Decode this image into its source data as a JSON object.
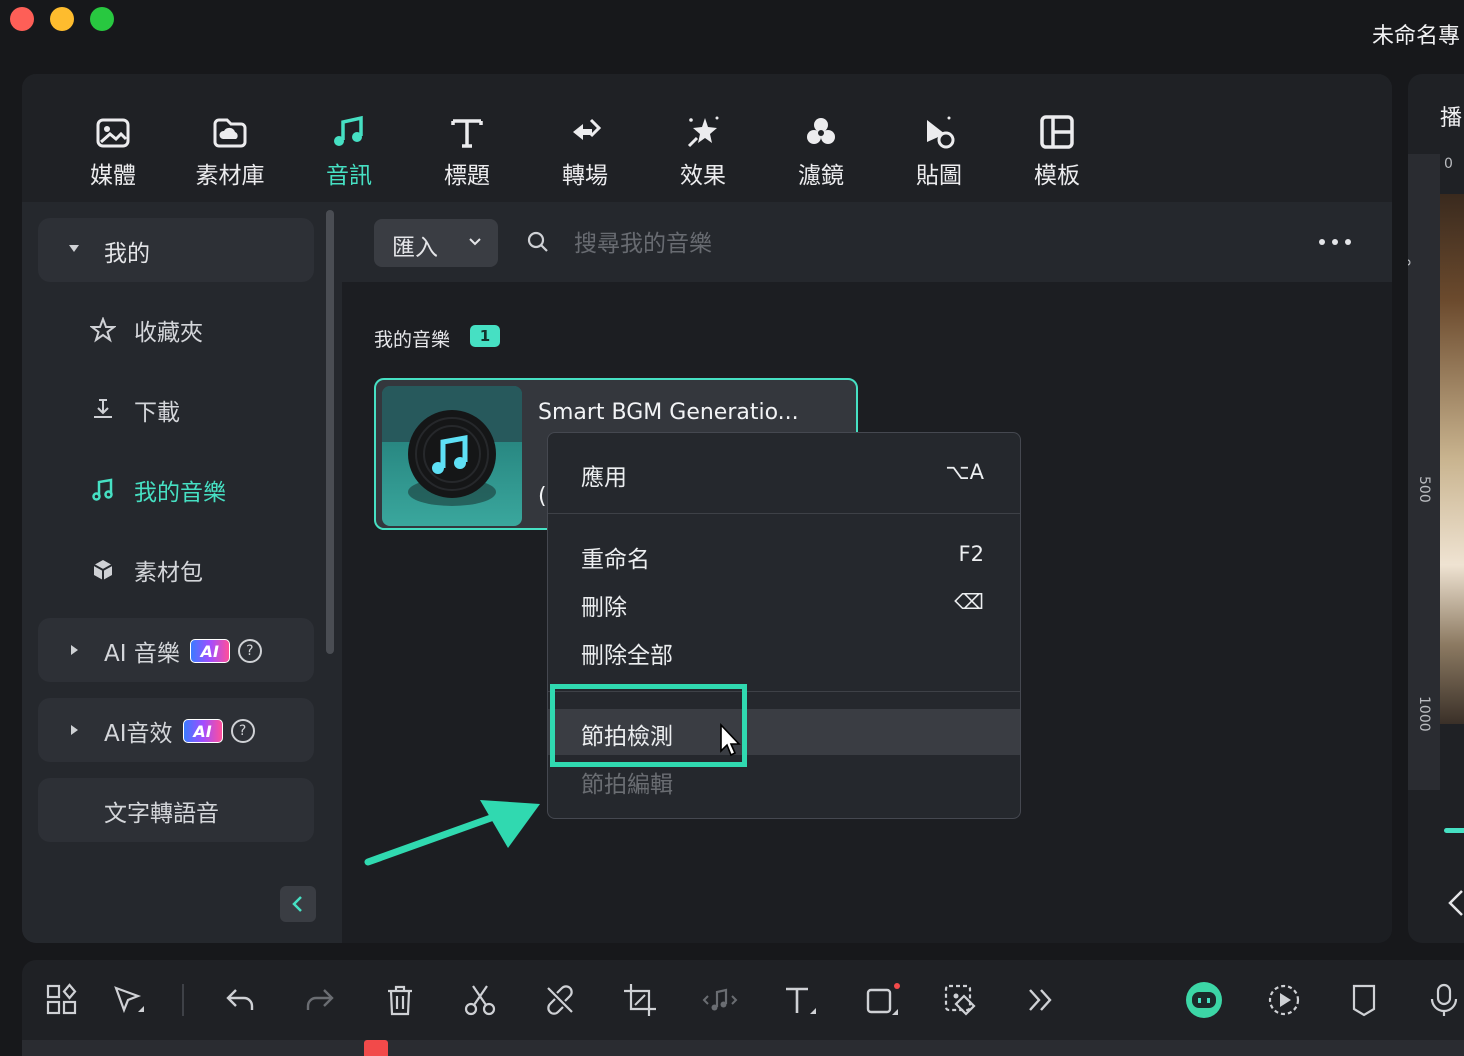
{
  "window": {
    "title": "未命名專",
    "traffic_colors": {
      "close": "#fe5f57",
      "minimize": "#febc2e",
      "zoom": "#28c840"
    }
  },
  "colors": {
    "accent": "#46e0c3",
    "highlight": "#30d9b0",
    "playhead": "#f24a4a"
  },
  "tabs": [
    {
      "label": "媒體",
      "icon": "media-icon"
    },
    {
      "label": "素材庫",
      "icon": "cloud-folder-icon"
    },
    {
      "label": "音訊",
      "icon": "music-note-icon",
      "active": true
    },
    {
      "label": "標題",
      "icon": "title-t-icon"
    },
    {
      "label": "轉場",
      "icon": "transition-icon"
    },
    {
      "label": "效果",
      "icon": "effects-icon"
    },
    {
      "label": "濾鏡",
      "icon": "filters-icon"
    },
    {
      "label": "貼圖",
      "icon": "stickers-icon"
    },
    {
      "label": "模板",
      "icon": "templates-icon"
    }
  ],
  "sidebar": {
    "my_group": "我的",
    "items": [
      {
        "label": "收藏夾",
        "icon": "star-icon"
      },
      {
        "label": "下載",
        "icon": "download-icon"
      },
      {
        "label": "我的音樂",
        "icon": "music-note-icon",
        "active": true
      },
      {
        "label": "素材包",
        "icon": "package-icon"
      }
    ],
    "ai_music": "AI 音樂",
    "ai_sfx": "AI音效",
    "ai_badge": "AI",
    "help_glyph": "?",
    "tts": "文字轉語音"
  },
  "toolbar": {
    "import_label": "匯入",
    "search_placeholder": "搜尋我的音樂"
  },
  "content": {
    "section_title": "我的音樂",
    "count": "1",
    "card": {
      "title": "Smart BGM Generatio...",
      "sub": "("
    }
  },
  "context_menu": {
    "items": [
      {
        "label": "應用",
        "shortcut": "⌥A"
      },
      {
        "label": "重命名",
        "shortcut": "F2"
      },
      {
        "label": "刪除",
        "shortcut": "⌫"
      },
      {
        "label": "刪除全部",
        "shortcut": ""
      },
      {
        "label": "節拍檢測",
        "shortcut": "",
        "hover": true
      },
      {
        "label": "節拍編輯",
        "shortcut": "",
        "disabled": true
      }
    ]
  },
  "preview": {
    "label": "播",
    "ruler_ticks": [
      "0",
      "0",
      "500",
      "1000"
    ]
  },
  "bottom_toolbar": [
    "layout-grid-icon",
    "select-arrow-icon",
    "undo-icon",
    "redo-icon",
    "delete-icon",
    "scissors-icon",
    "unlink-icon",
    "crop-icon",
    "audio-split-icon",
    "text-icon",
    "shape-record-icon",
    "mask-icon",
    "more-chevrons-icon",
    "ai-bot-icon",
    "play-auto-icon",
    "marker-icon",
    "microphone-icon"
  ]
}
